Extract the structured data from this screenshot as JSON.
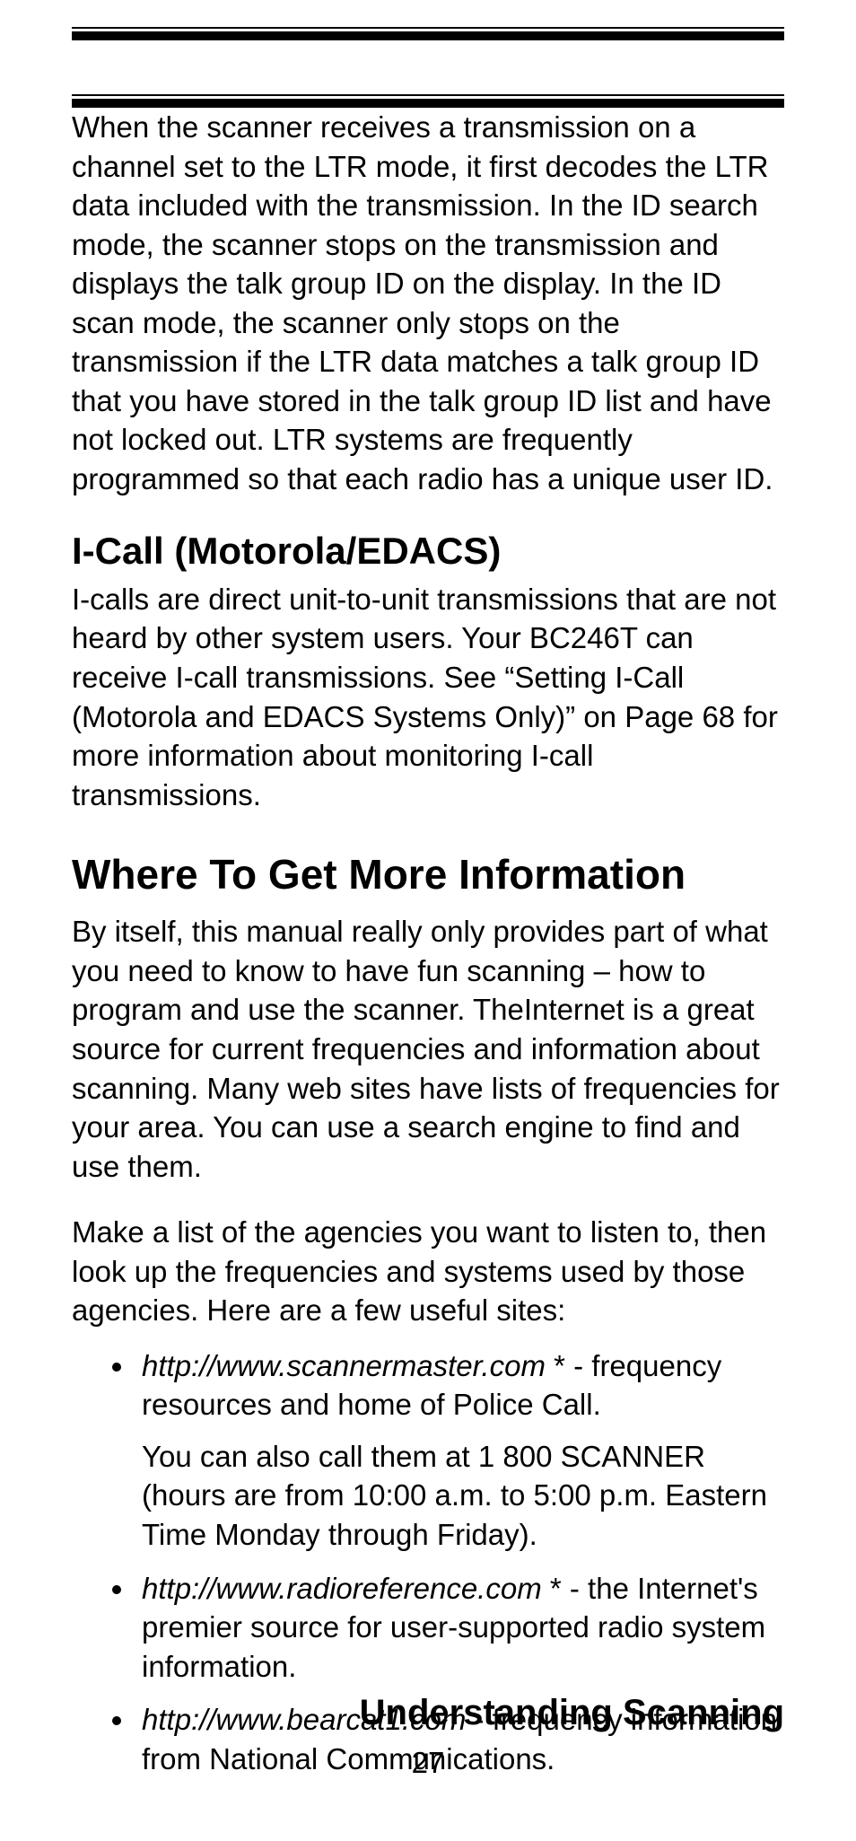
{
  "para_ltr": "When the scanner receives a transmission on a channel set to the LTR mode, it first decodes the LTR data included with the transmission. In the ID search mode, the scanner stops on the transmission and displays the talk group ID on the display. In the ID scan mode, the scanner only stops on the transmission if the LTR data matches a talk group ID that you have stored in the talk group ID list and have not locked out.  LTR systems are frequently programmed so that each radio has a unique user ID.",
  "heading_icall": "I-Call (Motorola/EDACS)",
  "para_icall": "I-calls are direct unit-to-unit transmissions that are not heard by other system users. Your BC246T can receive I-call transmissions. See “Setting I-Call (Motorola and EDACS Systems Only)” on Page 68 for more information about monitoring I-call transmissions.",
  "heading_where": "Where To Get More Information",
  "para_where1": "By itself, this manual really only provides part of what you need to know to have fun scanning – how to program and use the scanner. TheInternet is a great source for current frequencies and information about scanning. Many web sites have lists of frequencies for your area. You can use a search engine to find and use them.",
  "para_where2": "Make a list of the agencies you want to listen to, then look up the frequencies and systems used by those agencies. Here are a few useful sites:",
  "sites": [
    {
      "url": "http://www.scannermaster.com ",
      "asterisk": "*",
      "desc": " - frequency resources and home of Police Call.",
      "sub": "You can also call them at 1 800 SCANNER (hours are from 10:00 a.m. to 5:00 p.m. Eastern Time Monday through Friday)."
    },
    {
      "url": "http://www.radioreference.com",
      "asterisk": " *",
      "desc": " - the Internet's premier source for user-supported radio system information.",
      "sub": ""
    },
    {
      "url": "http://www.bearcat1.com",
      "asterisk": "",
      "desc": " - frequency information from National Communications.",
      "sub": ""
    }
  ],
  "footer_title": "Understanding Scanning",
  "page_number": "27"
}
